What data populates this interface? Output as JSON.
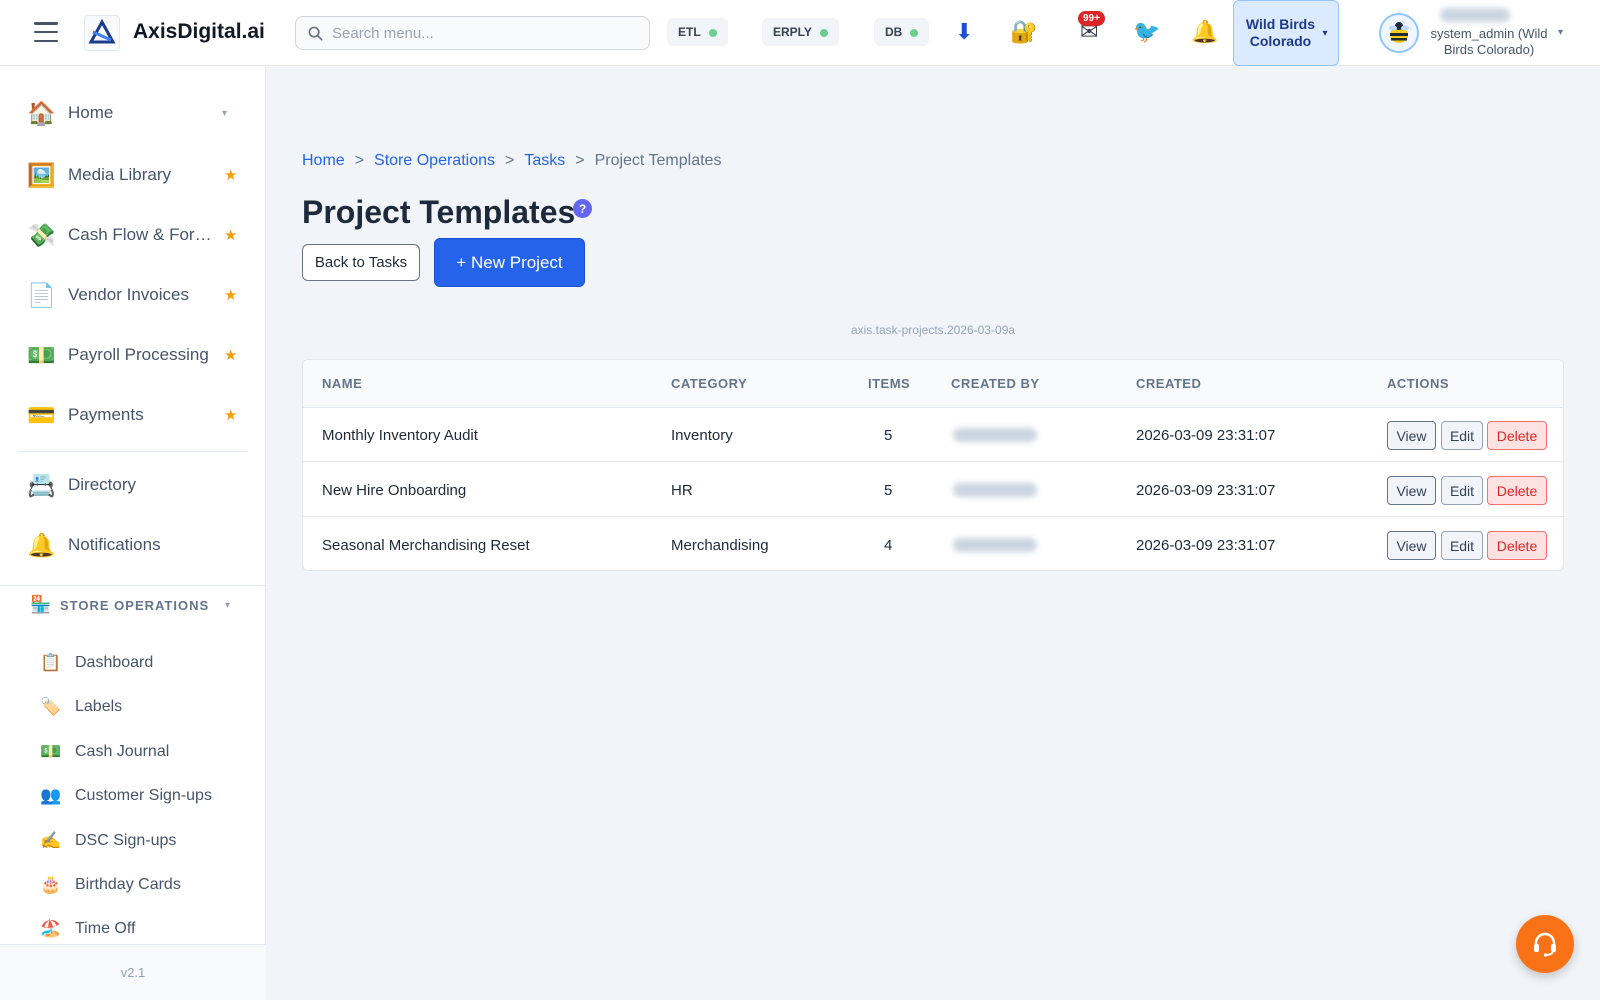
{
  "app": {
    "name": "AxisDigital.ai"
  },
  "search": {
    "placeholder": "Search menu..."
  },
  "status": [
    {
      "label": "ETL",
      "state": "ok",
      "color": "#6ccf8e"
    },
    {
      "label": "ERPLY",
      "state": "ok",
      "color": "#6ccf8e"
    },
    {
      "label": "DB",
      "state": "ok",
      "color": "#6ccf8e"
    }
  ],
  "toolbar": {
    "download_icon": "⬇",
    "lock_icon": "🔐",
    "mail_icon": "✉",
    "mail_badge": "99+",
    "bird_icon": "🐦",
    "bell_icon": "🔔"
  },
  "store": {
    "name": "Wild Birds Colorado",
    "caret": "▾"
  },
  "user": {
    "role": "system_admin (Wild Birds Colorado)",
    "caret": "▾"
  },
  "sidebar": {
    "items": [
      {
        "icon": "🏠",
        "icon_name": "home-icon",
        "label": "Home",
        "marker": "▾"
      },
      {
        "icon": "🖼️",
        "icon_name": "image-icon",
        "label": "Media Library",
        "marker": "★"
      },
      {
        "icon": "💸",
        "icon_name": "money-wings-icon",
        "label": "Cash Flow & For…",
        "marker": "★"
      },
      {
        "icon": "📄",
        "icon_name": "document-icon",
        "label": "Vendor Invoices",
        "marker": "★"
      },
      {
        "icon": "💵",
        "icon_name": "dollar-bill-icon",
        "label": "Payroll Processing",
        "marker": "★"
      },
      {
        "icon": "💳",
        "icon_name": "credit-card-icon",
        "label": "Payments",
        "marker": "★"
      },
      {
        "icon": "📇",
        "icon_name": "card-index-icon",
        "label": "Directory",
        "marker": ""
      },
      {
        "icon": "🔔",
        "icon_name": "bell-icon",
        "label": "Notifications",
        "marker": ""
      }
    ],
    "section": {
      "icon": "🏪",
      "label": "STORE OPERATIONS",
      "caret": "▾"
    },
    "sub_items": [
      {
        "icon": "📋",
        "icon_name": "clipboard-icon",
        "label": "Dashboard"
      },
      {
        "icon": "🏷️",
        "icon_name": "label-icon",
        "label": "Labels"
      },
      {
        "icon": "💵",
        "icon_name": "dollar-bill-icon",
        "label": "Cash Journal"
      },
      {
        "icon": "👥",
        "icon_name": "users-icon",
        "label": "Customer Sign-ups"
      },
      {
        "icon": "✍️",
        "icon_name": "writing-hand-icon",
        "label": "DSC Sign-ups"
      },
      {
        "icon": "🎂",
        "icon_name": "birthday-cake-icon",
        "label": "Birthday Cards"
      },
      {
        "icon": "🏖️",
        "icon_name": "beach-umbrella-icon",
        "label": "Time Off"
      }
    ],
    "version": "v2.1"
  },
  "breadcrumb": {
    "items": [
      "Home",
      "Store Operations",
      "Tasks"
    ],
    "current": "Project Templates",
    "separator": ">"
  },
  "page": {
    "title": "Project Templates",
    "help_label": "?",
    "back_label": "Back to Tasks",
    "new_label": "+ New Project",
    "version_tag": "axis.task-projects.2026-03-09a"
  },
  "table": {
    "headers": [
      "NAME",
      "CATEGORY",
      "ITEMS",
      "CREATED BY",
      "CREATED",
      "ACTIONS"
    ],
    "rows": [
      {
        "name": "Monthly Inventory Audit",
        "category": "Inventory",
        "items": "5",
        "created": "2026-03-09 23:31:07"
      },
      {
        "name": "New Hire Onboarding",
        "category": "HR",
        "items": "5",
        "created": "2026-03-09 23:31:07"
      },
      {
        "name": "Seasonal Merchandising Reset",
        "category": "Merchandising",
        "items": "4",
        "created": "2026-03-09 23:31:07"
      }
    ],
    "actions": {
      "view": "View",
      "edit": "Edit",
      "delete": "Delete"
    }
  },
  "colors": {
    "accent": "#2563eb",
    "danger": "#dc2626",
    "fab": "#f97316",
    "help": "#6366f1"
  }
}
